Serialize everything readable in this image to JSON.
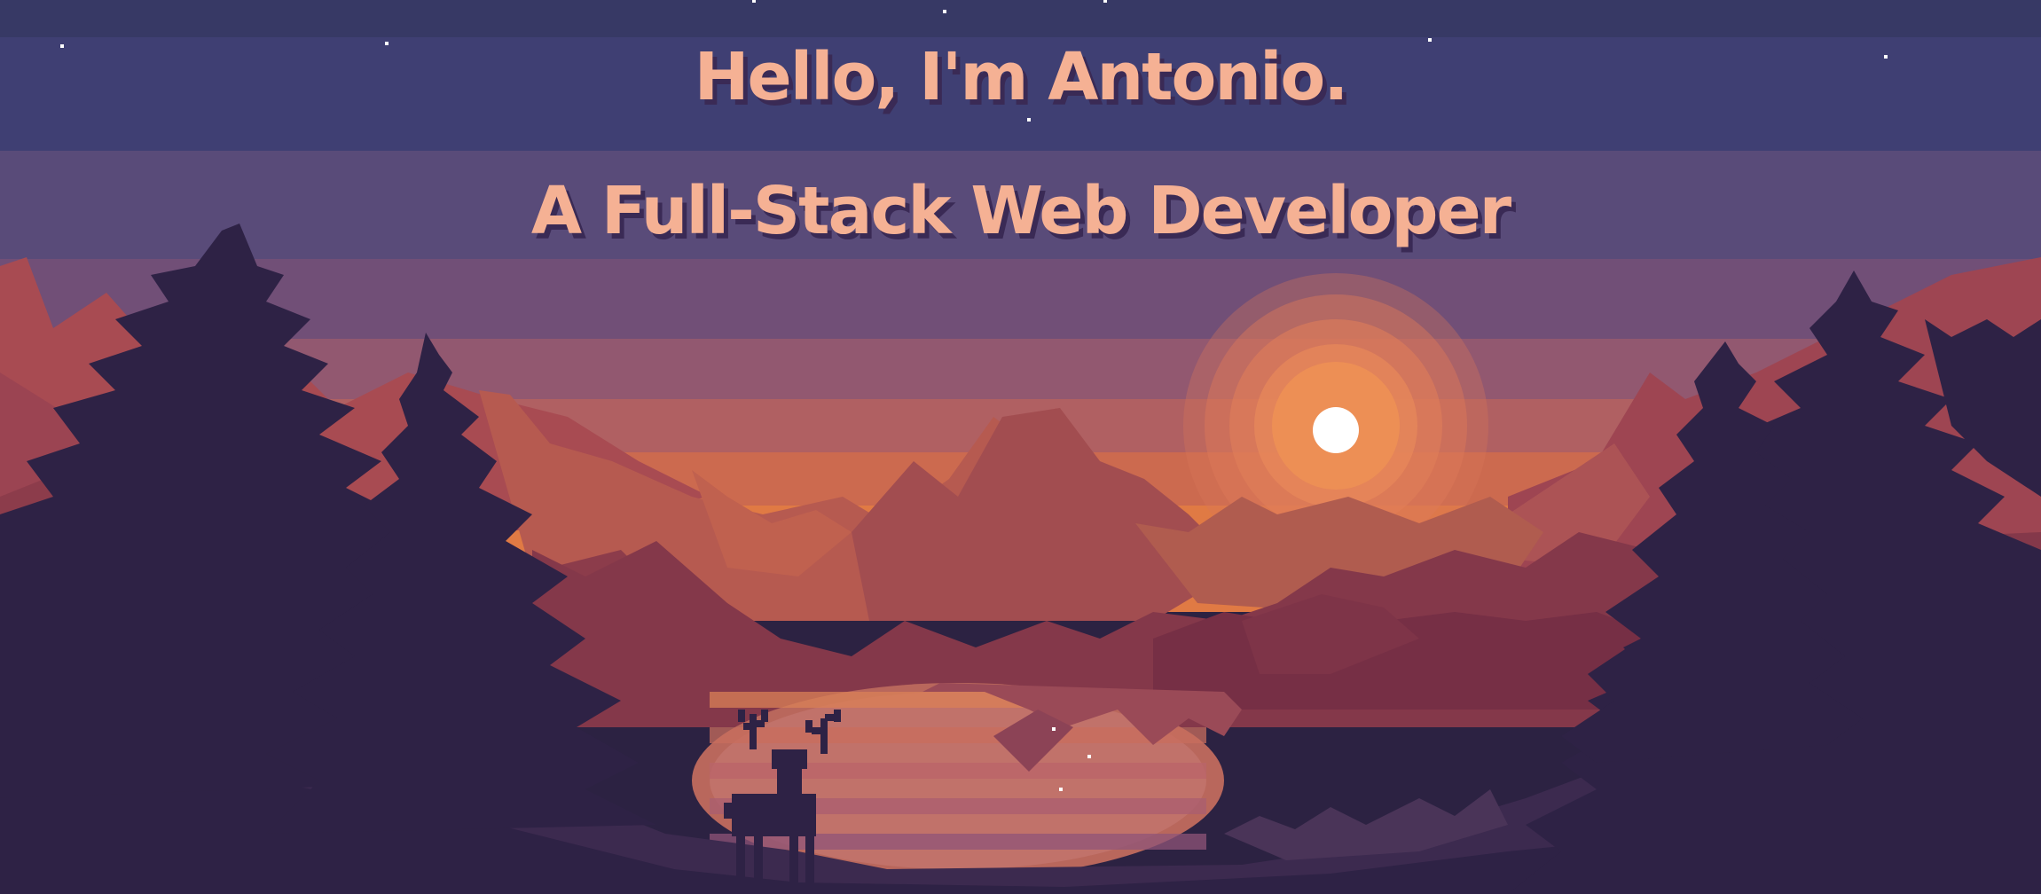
{
  "hero": {
    "greeting": "Hello, I'm Antonio.",
    "role": "A Full-Stack Web Developer"
  },
  "colors": {
    "headline_text": "#f5b194",
    "headline_shadow": "#3a2a55",
    "sky_bands": [
      "#383a66",
      "#403f74",
      "#594b7a",
      "#6e5078",
      "#8a5670",
      "#ad5f63",
      "#cc6a4f",
      "#e27b43"
    ],
    "mountain_far": "#9e4a50",
    "mountain_mid": "#8c3c4b",
    "mountain_near": "#6e3145",
    "tree_silhouette": "#2e2245",
    "lake": "#b06066",
    "sun": "#ffffff",
    "sun_glow": "#e8874f"
  },
  "icons": {
    "sun": "sun-icon",
    "deer": "deer-icon",
    "stars": "star-icon"
  }
}
